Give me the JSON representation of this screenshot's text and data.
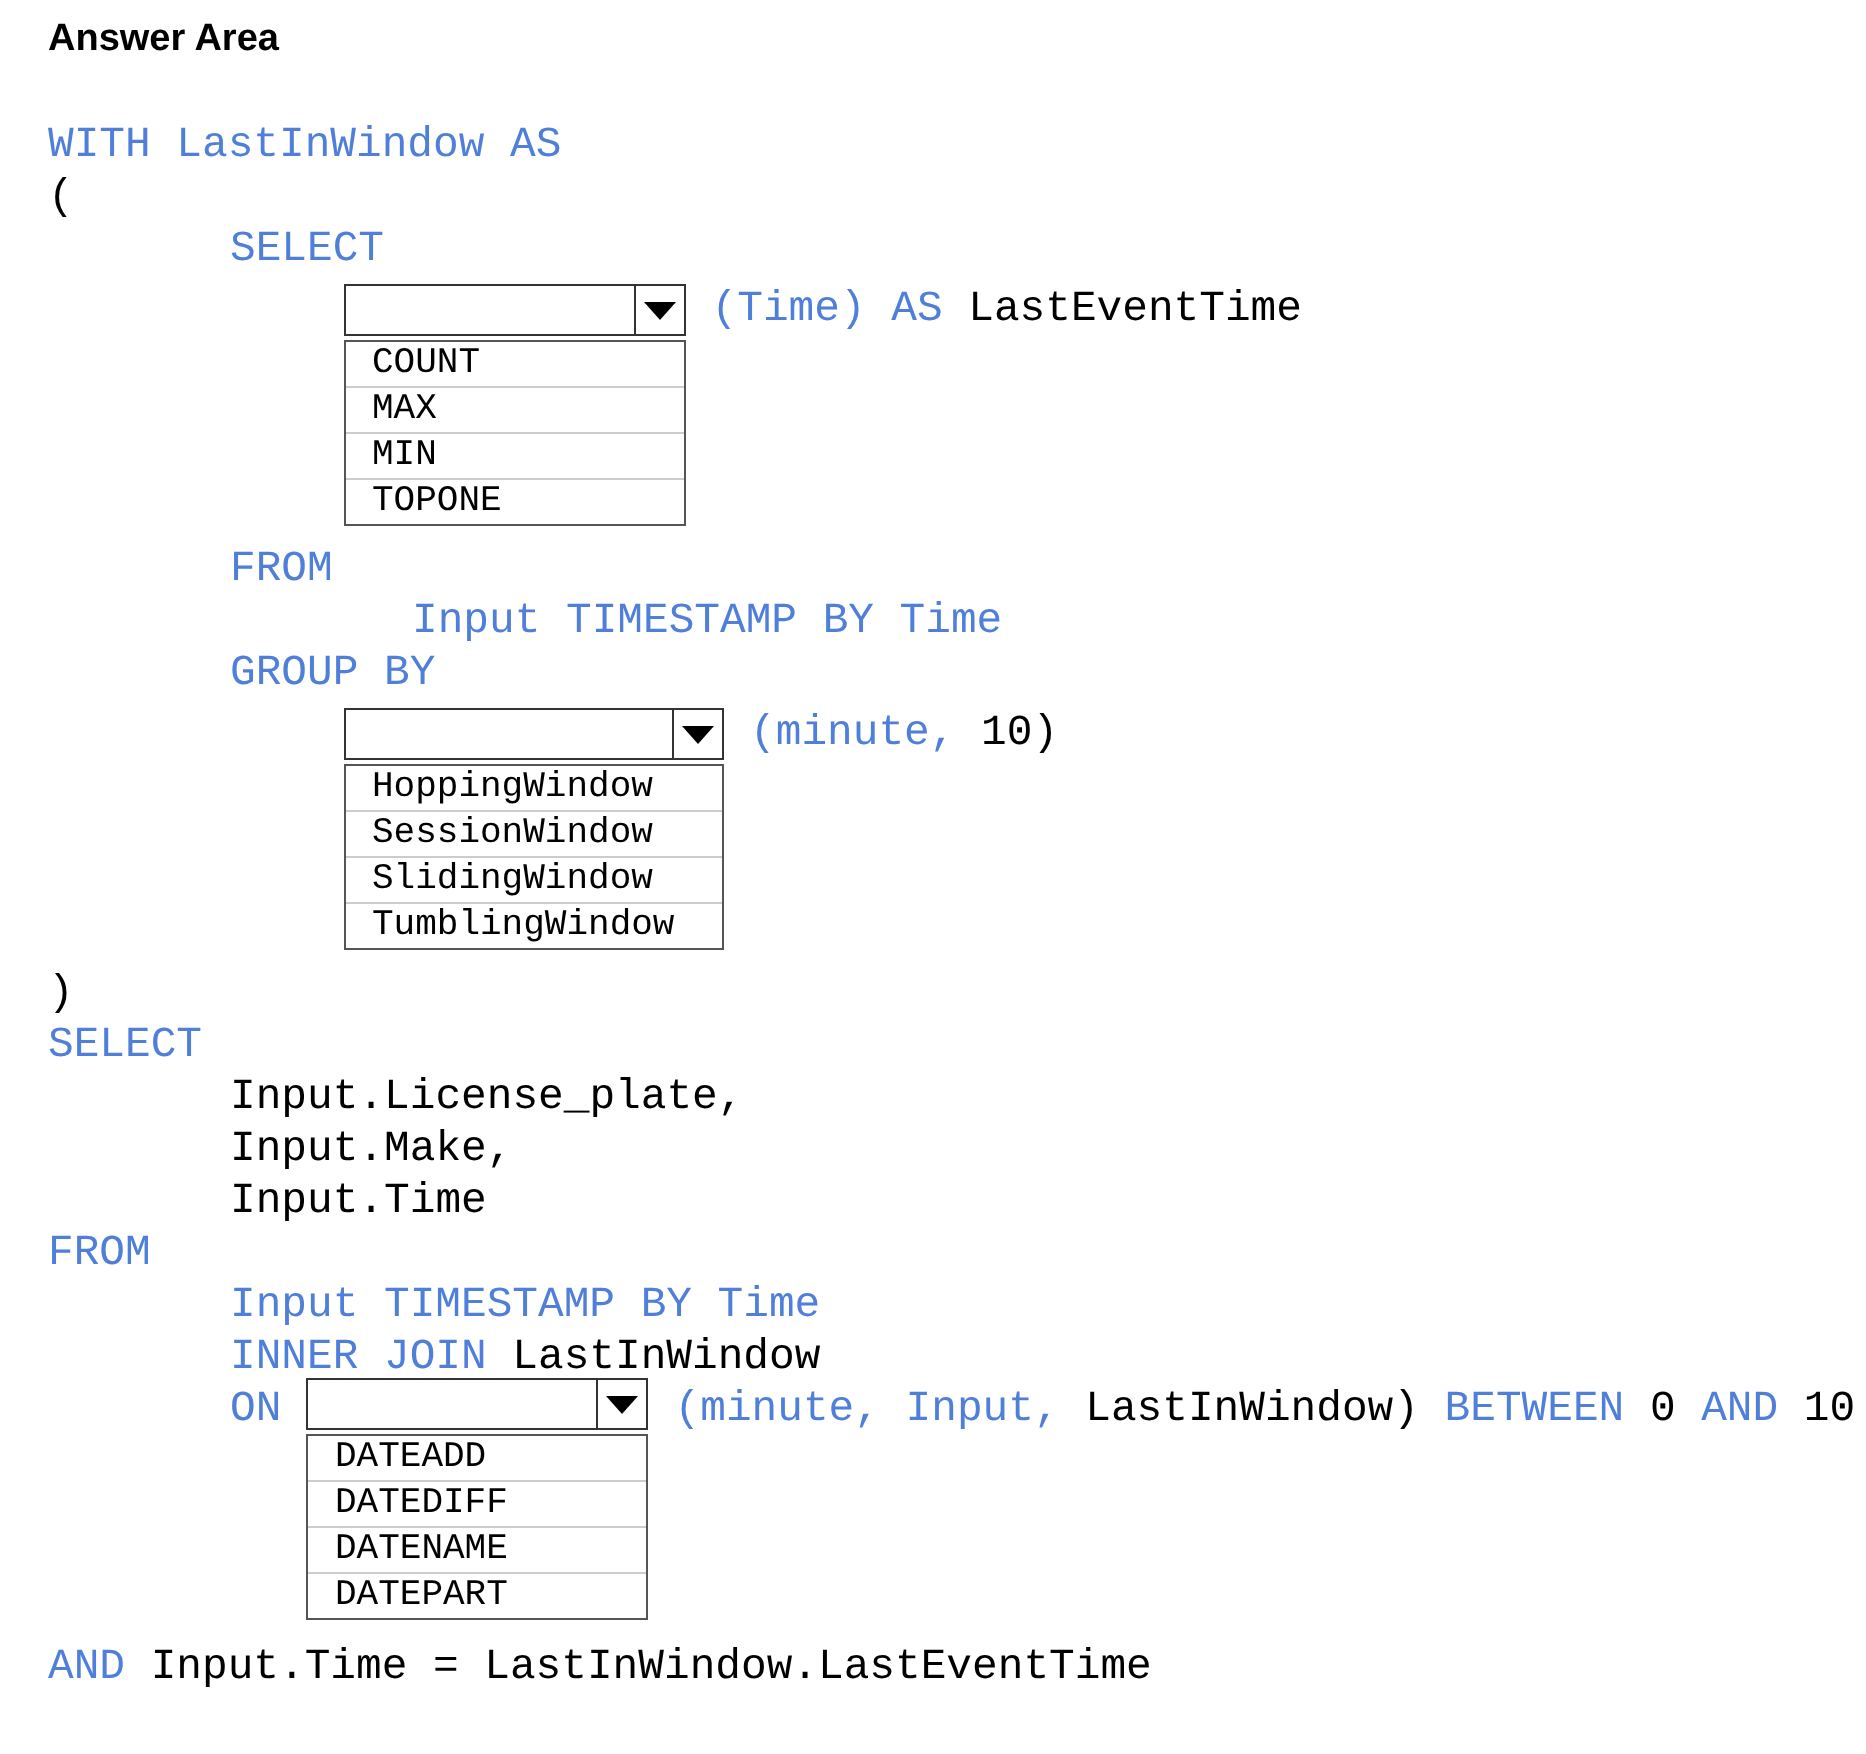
{
  "title": "Answer Area",
  "lines": [
    {
      "kind": "code",
      "tokens": [
        {
          "kind": "keyword",
          "text": "WITH"
        },
        {
          "kind": "keyword",
          "text": "LastInWindow"
        },
        {
          "kind": "keyword",
          "text": "AS"
        }
      ]
    },
    {
      "kind": "code",
      "tokens": [
        {
          "kind": "plain",
          "text": "("
        }
      ],
      "children": [
        {
          "kind": "code",
          "tokens": [
            {
              "kind": "keyword",
              "text": "SELECT"
            }
          ]
        },
        {
          "kind": "answer_row",
          "tokens": [
            {
              "kind": "dropdown",
              "options": [
                "COUNT",
                "MAX",
                "MIN",
                "TOPONE"
              ]
            },
            {
              "kind": "keyword",
              "text": "(Time)"
            },
            {
              "kind": "keyword",
              "text": "AS"
            },
            {
              "kind": "plain",
              "text": "LastEventTime"
            }
          ]
        },
        {
          "kind": "code",
          "tokens": [
            {
              "kind": "keyword",
              "text": "FROM"
            }
          ],
          "children": [
            {
              "kind": "code",
              "tokens": [
                {
                  "kind": "keyword",
                  "text": "Input"
                },
                {
                  "kind": "keyword",
                  "text": "TIMESTAMP"
                },
                {
                  "kind": "keyword",
                  "text": "BY"
                },
                {
                  "kind": "keyword",
                  "text": "Time"
                }
              ]
            }
          ]
        },
        {
          "kind": "code",
          "tokens": [
            {
              "kind": "keyword",
              "text": "GROUP"
            },
            {
              "kind": "keyword",
              "text": "BY"
            }
          ]
        },
        {
          "kind": "answer_row",
          "tokens": [
            {
              "kind": "dropdown",
              "options": [
                "HoppingWindow",
                "SessionWindow",
                "SlidingWindow",
                "TumblingWindow"
              ]
            },
            {
              "kind": "keyword",
              "text": "(minute,"
            },
            {
              "kind": "plain",
              "text": "10)"
            }
          ]
        }
      ]
    },
    {
      "kind": "code",
      "tokens": [
        {
          "kind": "plain",
          "text": ")"
        }
      ]
    },
    {
      "kind": "code",
      "tokens": [
        {
          "kind": "keyword",
          "text": "SELECT"
        }
      ],
      "children": [
        {
          "kind": "code",
          "tokens": [
            {
              "kind": "plain",
              "text": "Input.License_plate,"
            }
          ]
        },
        {
          "kind": "code",
          "tokens": [
            {
              "kind": "plain",
              "text": "Input.Make,"
            }
          ]
        },
        {
          "kind": "code",
          "tokens": [
            {
              "kind": "plain",
              "text": "Input.Time"
            }
          ]
        }
      ]
    },
    {
      "kind": "code",
      "tokens": [
        {
          "kind": "keyword",
          "text": "FROM"
        }
      ],
      "children": [
        {
          "kind": "code",
          "tokens": [
            {
              "kind": "keyword",
              "text": "Input"
            },
            {
              "kind": "keyword",
              "text": "TIMESTAMP"
            },
            {
              "kind": "keyword",
              "text": "BY"
            },
            {
              "kind": "keyword",
              "text": "Time"
            }
          ]
        },
        {
          "kind": "code",
          "tokens": [
            {
              "kind": "keyword",
              "text": "INNER"
            },
            {
              "kind": "keyword",
              "text": "JOIN"
            },
            {
              "kind": "plain",
              "text": "LastInWindow"
            }
          ]
        },
        {
          "kind": "code",
          "tokens": [
            {
              "kind": "keyword",
              "text": "ON"
            },
            {
              "kind": "dropdown",
              "options": [
                "DATEADD",
                "DATEDIFF",
                "DATENAME",
                "DATEPART"
              ]
            },
            {
              "kind": "keyword",
              "text": "(minute,"
            },
            {
              "kind": "keyword",
              "text": "Input,"
            },
            {
              "kind": "plain",
              "text": "LastInWindow)"
            },
            {
              "kind": "keyword",
              "text": "BETWEEN"
            },
            {
              "kind": "plain",
              "text": "0"
            },
            {
              "kind": "keyword",
              "text": "AND"
            },
            {
              "kind": "plain",
              "text": "10"
            }
          ]
        }
      ]
    },
    {
      "kind": "code",
      "tokens": [
        {
          "kind": "keyword",
          "text": "AND"
        },
        {
          "kind": "plain",
          "text": "Input.Time"
        },
        {
          "kind": "plain",
          "text": "="
        },
        {
          "kind": "plain",
          "text": "LastInWindow.LastEventTime"
        }
      ]
    }
  ]
}
